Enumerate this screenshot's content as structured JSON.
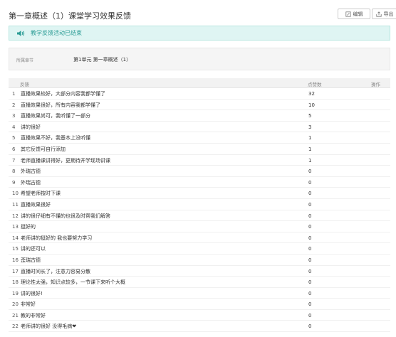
{
  "page": {
    "title": "第一章概述（1）课堂学习效果反馈",
    "edit_label": "编辑",
    "export_label": "导出"
  },
  "notice": {
    "icon": "speaker-icon",
    "text": "教学反馈活动已结束"
  },
  "info": {
    "chapter_label": "所属章节",
    "chapter_value": "第1单元 第一章概述（1）"
  },
  "table": {
    "headers": {
      "feedback": "反馈",
      "count": "点赞数",
      "action": "操作"
    },
    "rows": [
      {
        "idx": "1",
        "text": "直播效果较好，大部分内容我都学懂了",
        "count": "32"
      },
      {
        "idx": "2",
        "text": "直播效果很好，所有内容我都学懂了",
        "count": "10"
      },
      {
        "idx": "3",
        "text": "直播效果尚可，我听懂了一部分",
        "count": "5"
      },
      {
        "idx": "4",
        "text": "讲的很好",
        "count": "3"
      },
      {
        "idx": "5",
        "text": "直播效果不好，我基本上没听懂",
        "count": "1"
      },
      {
        "idx": "6",
        "text": "其它反馈可自行添加",
        "count": "1"
      },
      {
        "idx": "7",
        "text": "老师直播课讲得好，更期待开学现场讲课",
        "count": "1"
      },
      {
        "idx": "8",
        "text": "外瑞古德",
        "count": "0"
      },
      {
        "idx": "9",
        "text": "外瑞古德",
        "count": "0"
      },
      {
        "idx": "10",
        "text": "希望老师按时下课",
        "count": "0"
      },
      {
        "idx": "11",
        "text": "直播效果很好",
        "count": "0"
      },
      {
        "idx": "12",
        "text": "讲的很仔细有不懂的也很及时帮我们解答",
        "count": "0"
      },
      {
        "idx": "13",
        "text": "挺好的",
        "count": "0"
      },
      {
        "idx": "14",
        "text": "老师讲的挺好的 我也要努力学习",
        "count": "0"
      },
      {
        "idx": "15",
        "text": "讲的还可以",
        "count": "0"
      },
      {
        "idx": "16",
        "text": "歪瑞古德",
        "count": "0"
      },
      {
        "idx": "17",
        "text": "直播时间长了，注意力容易分散",
        "count": "0"
      },
      {
        "idx": "18",
        "text": "理论性太强，知识点较多，一节课下来听个大概",
        "count": "0"
      },
      {
        "idx": "19",
        "text": "讲的很好!",
        "count": "0"
      },
      {
        "idx": "20",
        "text": "非常好",
        "count": "0"
      },
      {
        "idx": "21",
        "text": "教的非常好",
        "count": "0"
      },
      {
        "idx": "22",
        "text": "老师讲的很好 没得毛病❤",
        "count": "0"
      }
    ]
  },
  "colors": {
    "accent": "#2b9c95",
    "notice_bg": "#dff5f3"
  }
}
